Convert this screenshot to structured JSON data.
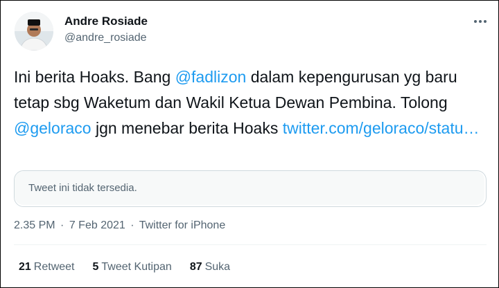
{
  "author": {
    "name": "Andre Rosiade",
    "handle": "@andre_rosiade"
  },
  "tweet": {
    "parts": [
      {
        "text": "Ini berita Hoaks. Bang ",
        "link": false
      },
      {
        "text": "@fadlizon",
        "link": true
      },
      {
        "text": " dalam kepengurusan yg baru tetap sbg Waketum dan Wakil Ketua Dewan Pembina. Tolong ",
        "link": false
      },
      {
        "text": "@geloraco",
        "link": true
      },
      {
        "text": " jgn menebar berita Hoaks ",
        "link": false
      },
      {
        "text": "twitter.com/geloraco/statu…",
        "link": true
      }
    ]
  },
  "quoted": {
    "unavailable_text": "Tweet ini tidak tersedia."
  },
  "meta": {
    "time": "2.35 PM",
    "separator": "·",
    "date": "7 Feb 2021",
    "source": "Twitter for iPhone"
  },
  "stats": {
    "retweets": {
      "count": "21",
      "label": "Retweet"
    },
    "quotes": {
      "count": "5",
      "label": "Tweet Kutipan"
    },
    "likes": {
      "count": "87",
      "label": "Suka"
    }
  },
  "colors": {
    "link": "#1d9bf0",
    "secondary": "#536471",
    "border": "#cfd9de"
  }
}
